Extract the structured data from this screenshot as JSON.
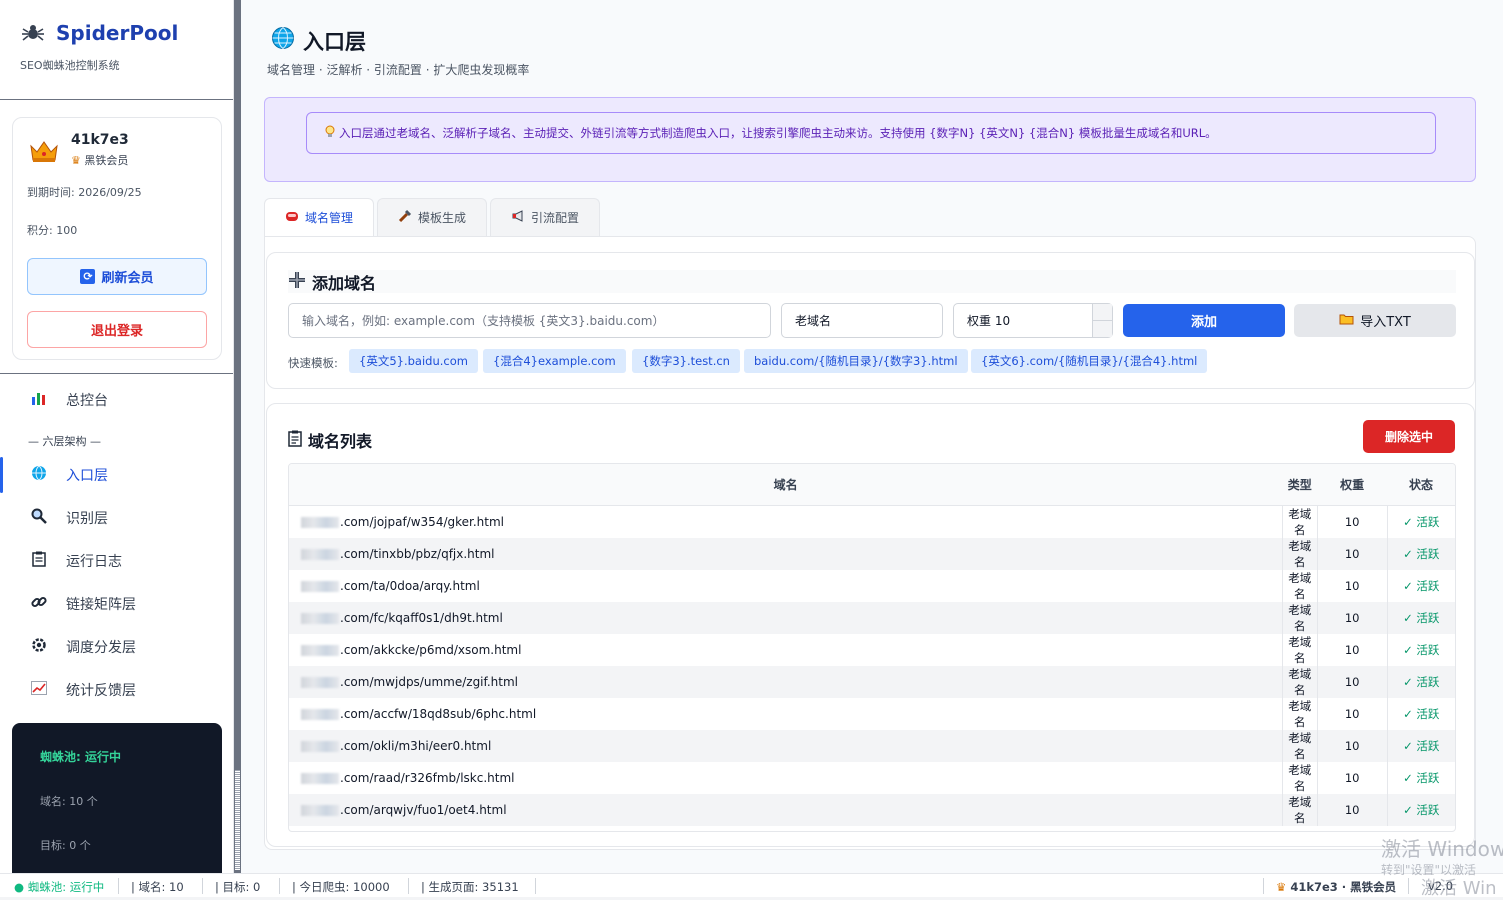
{
  "sidebar": {
    "brand": {
      "name": "SpiderPool",
      "subtitle": "SEO蜘蛛池控制系统",
      "logo_icon": "spider-icon"
    },
    "user": {
      "name": "41k7e3",
      "level": "黑铁会员",
      "expire": "到期时间: 2026/09/25",
      "points": "积分: 100",
      "refresh_label": "刷新会员",
      "logout_label": "退出登录"
    },
    "nav": [
      {
        "label": "总控台",
        "icon": "bar-chart-icon"
      },
      {
        "label": "入口层",
        "icon": "globe-icon",
        "active": true
      },
      {
        "label": "识别层",
        "icon": "magnifier-icon"
      },
      {
        "label": "运行日志",
        "icon": "clipboard-icon"
      },
      {
        "label": "链接矩阵层",
        "icon": "link-icon"
      },
      {
        "label": "调度分发层",
        "icon": "gear-icon"
      },
      {
        "label": "统计反馈层",
        "icon": "trend-chart-icon"
      }
    ],
    "section_label": "— 六层架构 —",
    "status": {
      "state": "蜘蛛池: 运行中",
      "domains": "域名: 10 个",
      "targets": "目标: 0 个"
    }
  },
  "header": {
    "title": "入口层",
    "subtitle": "域名管理 · 泛解析 · 引流配置 · 扩大爬虫发现概率"
  },
  "info_text": "入口层通过老域名、泛解析子域名、主动提交、外链引流等方式制造爬虫入口，让搜索引擎爬虫主动来访。支持使用 {数字N} {英文N} {混合N} 模板批量生成域名和URL。",
  "tabs": [
    {
      "label": "域名管理",
      "icon": "tag-icon",
      "active": true
    },
    {
      "label": "模板生成",
      "icon": "tool-icon"
    },
    {
      "label": "引流配置",
      "icon": "megaphone-icon"
    }
  ],
  "add_domain": {
    "title": "添加域名",
    "domain_placeholder": "输入域名，例如: example.com（支持模板 {英文3}.baidu.com）",
    "type_value": "老域名",
    "weight_value": "权重 10",
    "add_label": "添加",
    "import_label": "导入TXT",
    "quick_label": "快速模板:",
    "templates": [
      "{英文5}.baidu.com",
      "{混合4}example.com",
      "{数字3}.test.cn",
      "baidu.com/{随机目录}/{数字3}.html",
      "{英文6}.com/{随机目录}/{混合4}.html"
    ]
  },
  "domain_list": {
    "title": "域名列表",
    "delete_label": "删除选中",
    "columns": [
      "域名",
      "类型",
      "权重",
      "状态"
    ],
    "rows": [
      {
        "domain": ".com/jojpaf/w354/gker.html",
        "type": "老域名",
        "weight": "10",
        "status": "✓ 活跃"
      },
      {
        "domain": ".com/tinxbb/pbz/qfjx.html",
        "type": "老域名",
        "weight": "10",
        "status": "✓ 活跃"
      },
      {
        "domain": ".com/ta/0doa/arqy.html",
        "type": "老域名",
        "weight": "10",
        "status": "✓ 活跃"
      },
      {
        "domain": ".com/fc/kqaff0s1/dh9t.html",
        "type": "老域名",
        "weight": "10",
        "status": "✓ 活跃"
      },
      {
        "domain": ".com/akkcke/p6md/xsom.html",
        "type": "老域名",
        "weight": "10",
        "status": "✓ 活跃"
      },
      {
        "domain": ".com/mwjdps/umme/zgif.html",
        "type": "老域名",
        "weight": "10",
        "status": "✓ 活跃"
      },
      {
        "domain": ".com/accfw/18qd8sub/6phc.html",
        "type": "老域名",
        "weight": "10",
        "status": "✓ 活跃"
      },
      {
        "domain": ".com/okli/m3hi/eer0.html",
        "type": "老域名",
        "weight": "10",
        "status": "✓ 活跃"
      },
      {
        "domain": ".com/raad/r326fmb/lskc.html",
        "type": "老域名",
        "weight": "10",
        "status": "✓ 活跃"
      },
      {
        "domain": ".com/arqwjv/fuo1/oet4.html",
        "type": "老域名",
        "weight": "10",
        "status": "✓ 活跃"
      }
    ]
  },
  "statusbar": {
    "state": "● 蜘蛛池: 运行中",
    "domains": "域名: 10",
    "targets": "目标: 0",
    "crawls": "今日爬虫: 10000",
    "pages": "生成页面: 35131",
    "user": "41k7e3 · 黑铁会员",
    "version": "v2.0"
  },
  "watermark": {
    "line1": "激活 Windows",
    "line2": "转到\"设置\"以激活",
    "line3": "激活 Win"
  },
  "colors": {
    "accent": "#2563eb",
    "danger": "#dc2626",
    "success": "#059669",
    "info_bg": "#ede9fe"
  }
}
